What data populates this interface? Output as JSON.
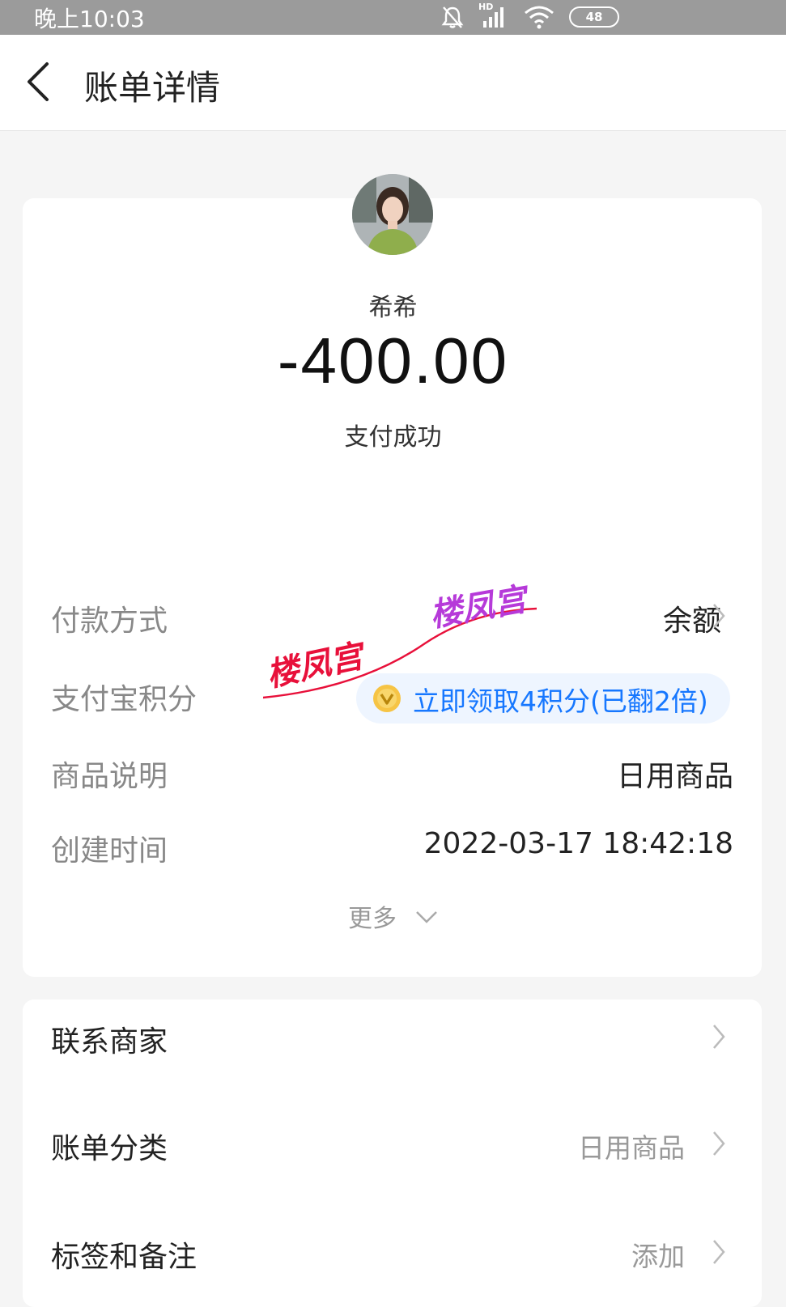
{
  "status_bar": {
    "time": "晚上10:03",
    "network_label": "HD",
    "battery": "48",
    "icons": [
      "bell-off-icon",
      "signal-icon",
      "wifi-icon",
      "battery-icon"
    ]
  },
  "header": {
    "title": "账单详情",
    "back_icon": "chevron-left-icon"
  },
  "summary": {
    "merchant_name": "希希",
    "amount": "-400.00",
    "status": "支付成功"
  },
  "details": {
    "payment_method_label": "付款方式",
    "payment_method_value": "余额",
    "points_label": "支付宝积分",
    "points_value": "立即领取4积分(已翻2倍)",
    "product_label": "商品说明",
    "product_value": "日用商品",
    "created_label": "创建时间",
    "created_value": "2022-03-17 18:42:18",
    "more_label": "更多"
  },
  "watermark": {
    "text_1": "楼凤宫",
    "text_2": "楼凤宫"
  },
  "actions": {
    "contact_label": "联系商家",
    "category_label": "账单分类",
    "category_value": "日用商品",
    "tags_label": "标签和备注",
    "tags_value": "添加"
  },
  "colors": {
    "accent": "#1677ff",
    "points_bg": "#eef5ff",
    "watermark_red": "#e8103a",
    "watermark_purple": "#b63ad9"
  }
}
